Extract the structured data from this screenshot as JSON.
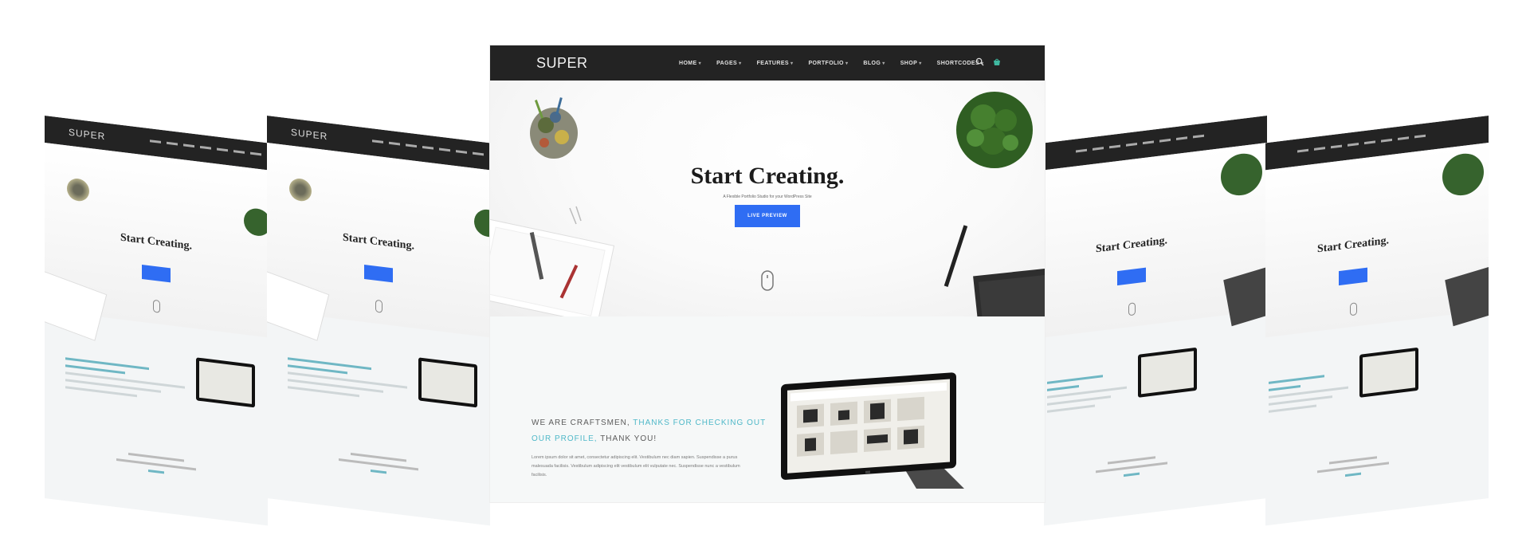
{
  "main": {
    "logo": "SUPER",
    "menu": [
      "HOME",
      "PAGES",
      "FEATURES",
      "PORTFOLIO",
      "BLOG",
      "SHOP",
      "SHORTCODES"
    ],
    "hero": {
      "title": "Start Creating.",
      "subtitle": "A Flexible Portfolio Studio for your WordPress Site",
      "button": "LIVE PREVIEW"
    },
    "about": {
      "prefix": "WE ARE CRAFTSMEN,",
      "accent": "THANKS FOR CHECKING OUT OUR PROFILE,",
      "suffix": "THANK YOU!",
      "body": "Lorem ipsum dolor sit amet, consectetur adipiscing elit. Vestibulum nec diam sapien. Suspendisse a purus malesuada facilisis. Vestibulum adipiscing elit vestibulum elit vulputate nec. Suspendisse nunc a vestibulum facilisis."
    }
  },
  "side": {
    "logo": "SUPER",
    "title": "Start Creating."
  },
  "colors": {
    "nav_bg": "#232323",
    "accent_blue": "#2f6df3",
    "accent_teal": "#4fb8c8"
  },
  "icons": [
    "search-icon",
    "cart-icon",
    "scroll-mouse-icon"
  ]
}
